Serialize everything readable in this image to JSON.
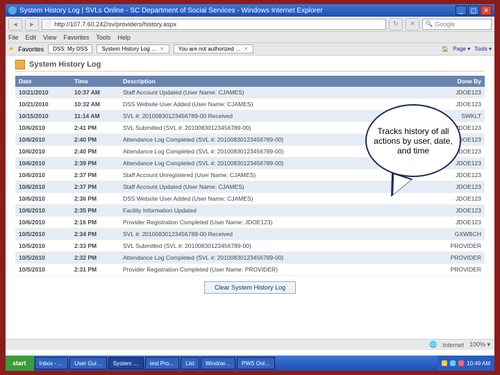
{
  "window": {
    "title": "System History Log  |  SVLs Online - SC Department of Social Services - Windows Internet Explorer",
    "min": "_",
    "max": "▢",
    "close": "✕"
  },
  "address": {
    "url": "http://107.7.60.242/sv/providers/history.aspx"
  },
  "search": {
    "placeholder": "Google"
  },
  "menu": {
    "file": "File",
    "edit": "Edit",
    "view": "View",
    "favorites": "Favorites",
    "tools": "Tools",
    "help": "Help"
  },
  "favbar": {
    "star": "Favorites",
    "tab1": "DSS: My DSS",
    "tab2": "System History Log …",
    "tab3": "You are not authorized …"
  },
  "toolright": {
    "home": "▾",
    "rss": "▾",
    "mail": "▾",
    "print": "▾",
    "page": "Page ▾",
    "safety": "▾",
    "tools": "Tools ▾"
  },
  "pagetitle": "System History Log",
  "table": {
    "hdr": {
      "date": "Date",
      "time": "Time",
      "desc": "Description",
      "done": "Done By"
    },
    "rows": [
      {
        "d": "10/21/2010",
        "t": "10:37 AM",
        "desc": "Staff Account Updated (User Name: CJAMES)",
        "by": "JDOE123"
      },
      {
        "d": "10/21/2010",
        "t": "10:32 AM",
        "desc": "DSS Website User Added (User Name: CJAMES)",
        "by": "JDOE123"
      },
      {
        "d": "10/15/2010",
        "t": "11:14 AM",
        "desc": "SVL #: 20100830123456789-00 Received",
        "by": "SWKLT"
      },
      {
        "d": "10/6/2010",
        "t": "2:41 PM",
        "desc": "SVL Submitted (SVL #: 20100830123456789-00)",
        "by": "JDOE123"
      },
      {
        "d": "10/6/2010",
        "t": "2:40 PM",
        "desc": "Attendance Log Completed (SVL #: 20100830123456789-00)",
        "by": "JDOE123"
      },
      {
        "d": "10/6/2010",
        "t": "2:40 PM",
        "desc": "Attendance Log Completed (SVL #: 20100830123456789-00)",
        "by": "JDOE123"
      },
      {
        "d": "10/6/2010",
        "t": "2:39 PM",
        "desc": "Attendance Log Completed (SVL #: 20100830123456789-00)",
        "by": "JDOE123"
      },
      {
        "d": "10/6/2010",
        "t": "2:37 PM",
        "desc": "Staff Account Unregistered (User Name: CJAMES)",
        "by": "JDOE123"
      },
      {
        "d": "10/6/2010",
        "t": "2:37 PM",
        "desc": "Staff Account Updated (User Name: CJAMES)",
        "by": "JDOE123"
      },
      {
        "d": "10/6/2010",
        "t": "2:36 PM",
        "desc": "DSS Website User Added (User Name: CJAMES)",
        "by": "JDOE123"
      },
      {
        "d": "10/6/2010",
        "t": "2:35 PM",
        "desc": "Facility Information Updated",
        "by": "JDOE123"
      },
      {
        "d": "10/6/2010",
        "t": "2:16 PM",
        "desc": "Provider Registration Completed (User Name: JDOE123)",
        "by": "JDOE123"
      },
      {
        "d": "10/5/2010",
        "t": "2:34 PM",
        "desc": "SVL #: 20100830123456789-00 Received",
        "by": "GXWBCH"
      },
      {
        "d": "10/5/2010",
        "t": "2:33 PM",
        "desc": "SVL Submitted (SVL #: 20100830123456789-00)",
        "by": "PROVIDER"
      },
      {
        "d": "10/5/2010",
        "t": "2:32 PM",
        "desc": "Attendance Log Completed (SVL #: 20100830123456789-00)",
        "by": "PROVIDER"
      },
      {
        "d": "10/5/2010",
        "t": "2:31 PM",
        "desc": "Provider Registration Completed (User Name: PROVIDER)",
        "by": "PROVIDER"
      }
    ]
  },
  "clearbtn": "Clear System History Log",
  "statusbar": {
    "internet": "Internet",
    "zoom": "100%  ▾"
  },
  "callout": "Tracks history of all actions by user, date, and time",
  "taskbar": {
    "start": "start",
    "items": [
      "Inbox - …",
      "User Gui…",
      "System …",
      "test Pro…",
      "List",
      "Window…",
      "PWS Onl…"
    ],
    "time": "10:49 AM"
  }
}
